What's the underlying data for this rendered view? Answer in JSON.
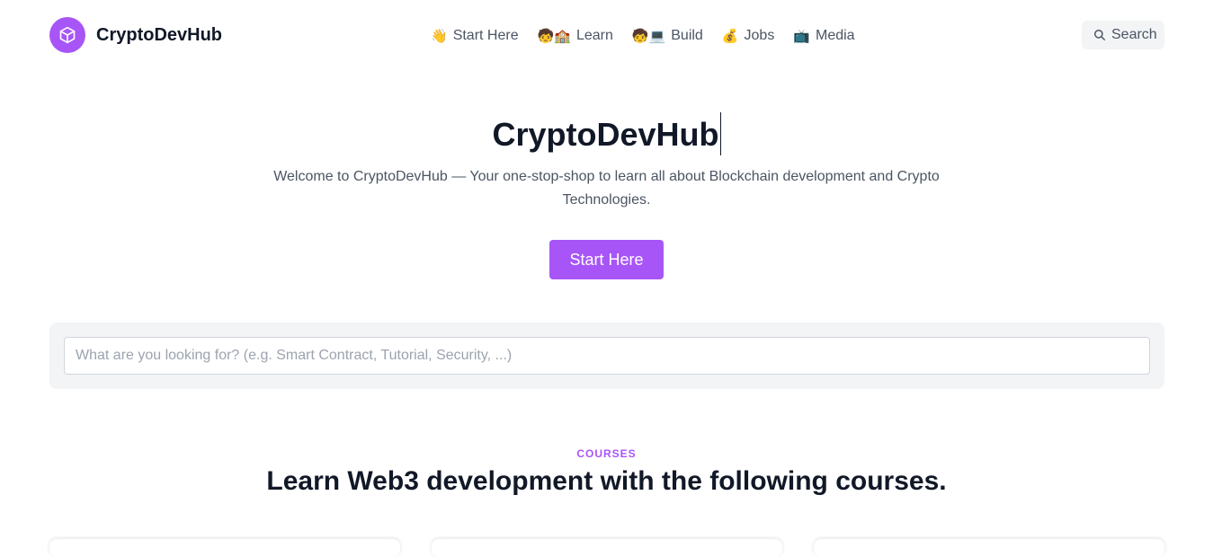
{
  "brand": {
    "name": "CryptoDevHub",
    "logo_icon": "cube-icon",
    "logo_color": "#a855f7"
  },
  "nav": [
    {
      "label": "Start Here",
      "emoji": "👋"
    },
    {
      "label": "Learn",
      "emoji": "🧒🏫"
    },
    {
      "label": "Build",
      "emoji": "🧒💻"
    },
    {
      "label": "Jobs",
      "emoji": "💰"
    },
    {
      "label": "Media",
      "emoji": "📺"
    }
  ],
  "header_search": {
    "label": "Search",
    "icon": "search-icon"
  },
  "hero": {
    "title": "CryptoDevHub",
    "subtitle": "Welcome to CryptoDevHub — Your one-stop-shop to learn all about Blockchain development and Crypto Technologies.",
    "cta_label": "Start Here"
  },
  "search": {
    "placeholder": "What are you looking for? (e.g. Smart Contract, Tutorial, Security, ...)",
    "value": ""
  },
  "courses": {
    "kicker": "COURSES",
    "title": "Learn Web3 development with the following courses."
  },
  "colors": {
    "accent": "#a855f7",
    "text": "#111827",
    "muted": "#4b5563",
    "panel": "#f3f4f6"
  }
}
